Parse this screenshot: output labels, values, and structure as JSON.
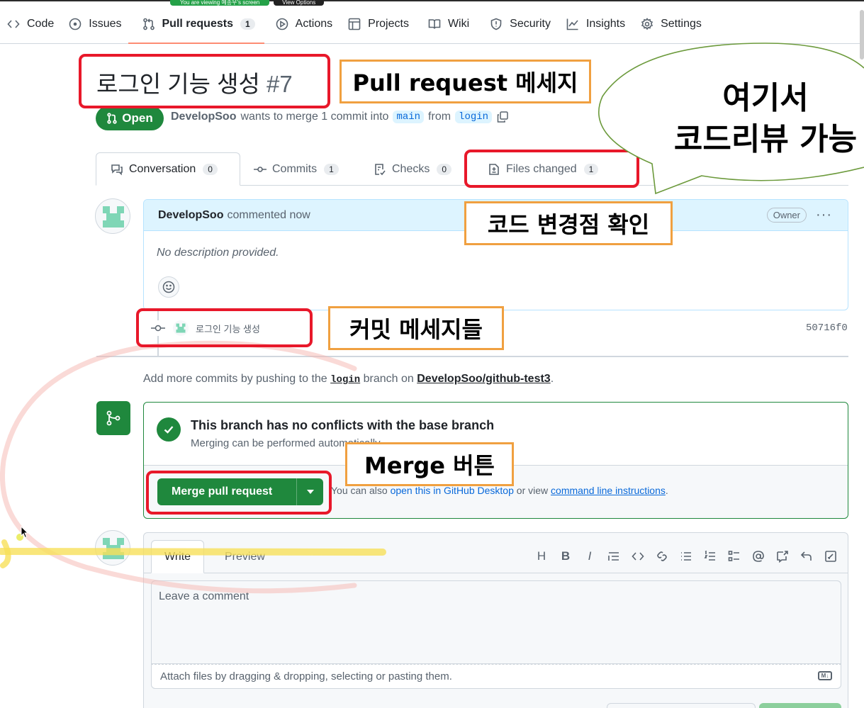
{
  "zoom_banner": {
    "viewing": "You are viewing 예종우's screen",
    "options": "View Options"
  },
  "nav": {
    "items": [
      {
        "label": "Code",
        "icon": "code-icon"
      },
      {
        "label": "Issues",
        "icon": "issue-icon"
      },
      {
        "label": "Pull requests",
        "icon": "pull-request-icon",
        "count": "1",
        "active": true
      },
      {
        "label": "Actions",
        "icon": "play-icon"
      },
      {
        "label": "Projects",
        "icon": "table-icon"
      },
      {
        "label": "Wiki",
        "icon": "book-icon"
      },
      {
        "label": "Security",
        "icon": "shield-icon"
      },
      {
        "label": "Insights",
        "icon": "graph-icon"
      },
      {
        "label": "Settings",
        "icon": "gear-icon"
      }
    ]
  },
  "pr": {
    "title": "로그인 기능 생성",
    "number": "#7",
    "state": "Open",
    "author": "DevelopSoo",
    "merge_text": "wants to merge 1 commit into",
    "base": "main",
    "from_text": "from",
    "head": "login"
  },
  "tabs": [
    {
      "label": "Conversation",
      "count": "0",
      "icon": "comment-icon"
    },
    {
      "label": "Commits",
      "count": "1",
      "icon": "commit-icon"
    },
    {
      "label": "Checks",
      "count": "0",
      "icon": "checklist-icon"
    },
    {
      "label": "Files changed",
      "count": "1",
      "icon": "file-diff-icon"
    }
  ],
  "comment": {
    "author": "DevelopSoo",
    "action": "commented now",
    "badge": "Owner",
    "body": "No description provided."
  },
  "commit": {
    "message": "로그인 기능 생성",
    "sha": "50716f0"
  },
  "push_hint": {
    "before": "Add more commits by pushing to the",
    "branch": "login",
    "middle": "branch on",
    "repo": "DevelopSoo/github-test3",
    "end": "."
  },
  "merge": {
    "title": "This branch has no conflicts with the base branch",
    "subtitle": "Merging can be performed automatically.",
    "button": "Merge pull request",
    "also": "You can also",
    "desktop_link": "open this in GitHub Desktop",
    "or_view": "or view",
    "cli_link": "command line instructions",
    "end": "."
  },
  "editor": {
    "write_tab": "Write",
    "preview_tab": "Preview",
    "placeholder": "Leave a comment",
    "attach": "Attach files by dragging & dropping, selecting or pasting them.",
    "toolbar": [
      "H",
      "B",
      "I"
    ]
  },
  "annotations": {
    "pr_message": "Pull request 메세지",
    "review_line1": "여기서",
    "review_line2": "코드리뷰 가능",
    "code_changes": "코드 변경점 확인",
    "commit_messages": "커밋 메세지들",
    "merge_button": "Merge 버튼"
  },
  "colors": {
    "green": "#1f883d",
    "link": "#0969da",
    "annotation_red": "#e8182a",
    "annotation_orange": "#f0a040"
  }
}
